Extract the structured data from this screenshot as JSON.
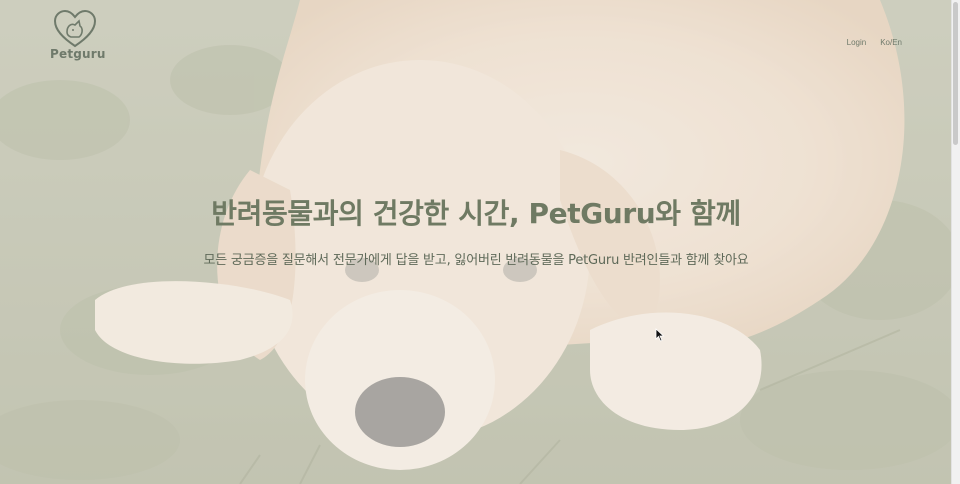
{
  "header": {
    "logo_text": "Petguru",
    "nav": {
      "login_label": "Login",
      "language_label": "Ko/En"
    }
  },
  "hero": {
    "title": "반려동물과의 건강한 시간, PetGuru와 함께",
    "subtitle": "모든 궁금증을 질문해서 전문가에게 답을 받고, 잃어버린 반려동물을 PetGuru 반려인들과 함께 찾아요"
  },
  "colors": {
    "brand_text": "#6f7a63",
    "overlay": "#f0ece6"
  },
  "icons": {
    "logo": "heart-pet-logo-icon",
    "cursor": "mouse-cursor-icon"
  }
}
